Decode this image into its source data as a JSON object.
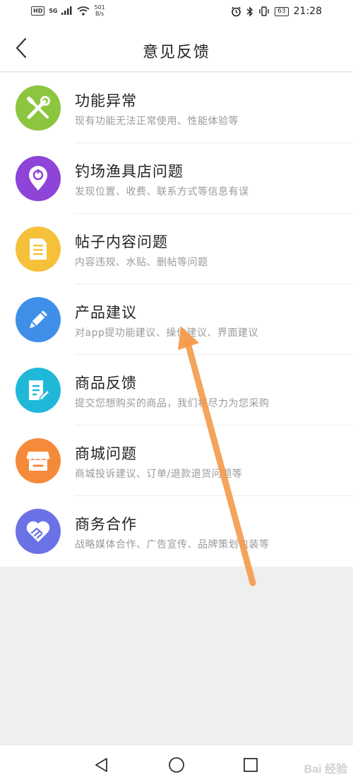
{
  "status_bar": {
    "hd": "HD",
    "signal": "5G",
    "net_speed_value": "501",
    "net_speed_unit": "B/s",
    "battery": "63",
    "time": "21:28"
  },
  "header": {
    "title": "意见反馈"
  },
  "items": [
    {
      "title": "功能异常",
      "desc": "现有功能无法正常使用、性能体验等",
      "icon": "wrench-screwdriver-icon",
      "color": "#8cc63f"
    },
    {
      "title": "钓场渔具店问题",
      "desc": "发现位置、收费、联系方式等信息有误",
      "icon": "location-pin-icon",
      "color": "#8e44d6"
    },
    {
      "title": "帖子内容问题",
      "desc": "内容违规、水贴、删帖等问题",
      "icon": "document-icon",
      "color": "#f5c13b"
    },
    {
      "title": "产品建议",
      "desc": "对app提功能建议、操作建议、界面建议",
      "icon": "pencil-icon",
      "color": "#3f8fe8"
    },
    {
      "title": "商品反馈",
      "desc": "提交您想购买的商品，我们将尽力为您采购",
      "icon": "edit-note-icon",
      "color": "#1fb8d9"
    },
    {
      "title": "商城问题",
      "desc": "商城投诉建议、订单/退款退货问题等",
      "icon": "store-icon",
      "color": "#f58a3a"
    },
    {
      "title": "商务合作",
      "desc": "战略媒体合作、广告宣传、品牌策划包装等",
      "icon": "handshake-heart-icon",
      "color": "#6b72e6"
    }
  ],
  "watermark": "Bai 经验",
  "annotation_color": "#f39a4a"
}
